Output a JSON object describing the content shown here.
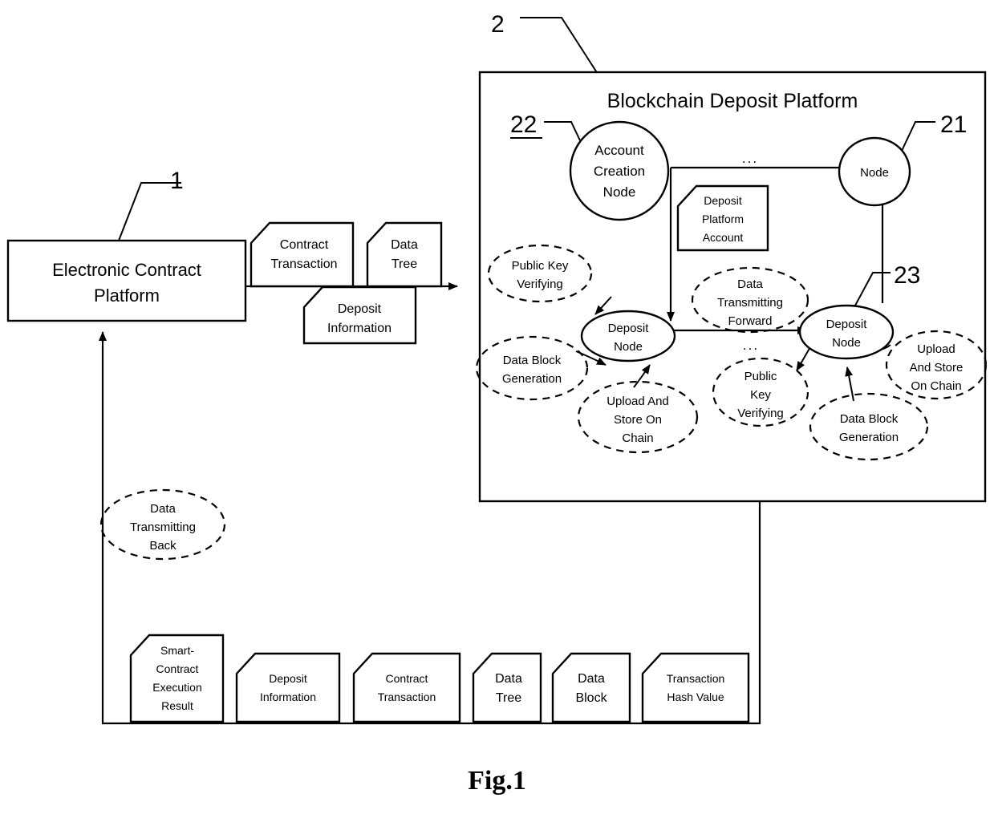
{
  "figure": {
    "caption": "Fig.1"
  },
  "reference_numerals": {
    "electronic_contract_platform": "1",
    "blockchain_deposit_platform": "2",
    "node": "21",
    "account_creation_node": "22",
    "deposit_node": "23"
  },
  "left_platform": {
    "label_line1": "Electronic Contract",
    "label_line2": "Platform"
  },
  "blockchain_platform": {
    "title": "Blockchain Deposit Platform",
    "ellipsis_top": "...",
    "ellipsis_mid": "...",
    "nodes": {
      "account_creation": {
        "line1": "Account",
        "line2": "Creation",
        "line3": "Node"
      },
      "generic_node": {
        "line1": "Node"
      },
      "deposit_node_left": {
        "line1": "Deposit",
        "line2": "Node"
      },
      "deposit_node_right": {
        "line1": "Deposit",
        "line2": "Node"
      }
    },
    "deposit_platform_account_doc": {
      "line1": "Deposit",
      "line2": "Platform",
      "line3": "Account"
    },
    "left_process_ellipses": [
      {
        "name": "public-key-verifying",
        "line1": "Public Key",
        "line2": "Verifying"
      },
      {
        "name": "data-block-generation",
        "line1": "Data Block",
        "line2": "Generation"
      },
      {
        "name": "upload-and-store-on-chain",
        "line1": "Upload And",
        "line2": "Store On",
        "line3": "Chain"
      }
    ],
    "right_process_ellipses": [
      {
        "name": "data-transmitting-forward",
        "line1": "Data",
        "line2": "Transmitting",
        "line3": "Forward"
      },
      {
        "name": "public-key-verifying",
        "line1": "Public",
        "line2": "Key",
        "line3": "Verifying"
      },
      {
        "name": "data-block-generation",
        "line1": "Data Block",
        "line2": "Generation"
      },
      {
        "name": "upload-and-store-on-chain",
        "line1": "Upload",
        "line2": "And Store",
        "line3": "On Chain"
      }
    ]
  },
  "data_transmitting_back": {
    "line1": "Data",
    "line2": "Transmitting",
    "line3": "Back"
  },
  "input_documents": [
    {
      "name": "contract-transaction",
      "line1": "Contract",
      "line2": "Transaction"
    },
    {
      "name": "data-tree",
      "line1": "Data",
      "line2": "Tree"
    },
    {
      "name": "deposit-information",
      "line1": "Deposit",
      "line2": "Information"
    }
  ],
  "return_documents": [
    {
      "name": "smart-contract-execution-result",
      "line1": "Smart-",
      "line2": "Contract",
      "line3": "Execution",
      "line4": "Result"
    },
    {
      "name": "deposit-information",
      "line1": "Deposit",
      "line2": "Information"
    },
    {
      "name": "contract-transaction",
      "line1": "Contract",
      "line2": "Transaction"
    },
    {
      "name": "data-tree",
      "line1": "Data",
      "line2": "Tree"
    },
    {
      "name": "data-block",
      "line1": "Data",
      "line2": "Block"
    },
    {
      "name": "transaction-hash-value",
      "line1": "Transaction",
      "line2": "Hash Value"
    }
  ],
  "colors": {
    "stroke": "#000000",
    "background": "#ffffff"
  }
}
